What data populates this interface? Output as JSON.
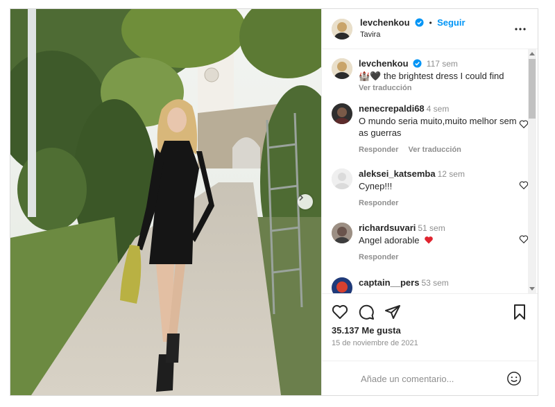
{
  "post": {
    "author": "levchenkou",
    "follow_label": "Seguir",
    "dot": "•",
    "location": "Tavira",
    "caption": {
      "username": "levchenkou",
      "time": "117 sem",
      "emojis": "🏰🖤",
      "text": "the brightest dress I could find",
      "see_translation": "Ver traducción"
    },
    "comments": [
      {
        "username": "nenecrepaldi68",
        "time": "4 sem",
        "text": "O mundo seria muito,muito melhor sem as guerras",
        "reply": "Responder",
        "translate": "Ver traducción"
      },
      {
        "username": "aleksei_katsemba",
        "time": "12 sem",
        "text": "Супер!!!",
        "reply": "Responder",
        "translate": ""
      },
      {
        "username": "richardsuvari",
        "time": "51 sem",
        "text": "Angel adorable",
        "reply": "Responder",
        "translate": ""
      },
      {
        "username": "captain__pers",
        "time": "53 sem",
        "text": "",
        "reply": "",
        "translate": ""
      }
    ],
    "likes": "35.137 Me gusta",
    "date": "15 de noviembre de 2021",
    "comment_placeholder": "Añade un comentario..."
  },
  "colors": {
    "accent": "#0095f6",
    "verified": "#0095f6",
    "heart_red": "#ed4956",
    "muted": "#8e8e8e"
  },
  "icons": [
    "verified-badge-icon",
    "more-options-icon",
    "like-heart-icon",
    "comment-icon",
    "share-icon",
    "save-bookmark-icon",
    "emoji-icon",
    "carousel-next-icon"
  ]
}
